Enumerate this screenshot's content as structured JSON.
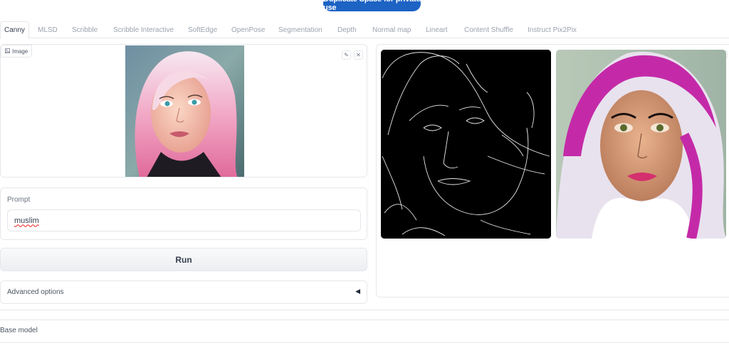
{
  "header": {
    "duplicate_label": "Duplicate Space for private use"
  },
  "tabs": [
    {
      "label": "Canny",
      "active": true
    },
    {
      "label": "MLSD"
    },
    {
      "label": "Scribble"
    },
    {
      "label": "Scribble Interactive"
    },
    {
      "label": "SoftEdge"
    },
    {
      "label": "OpenPose"
    },
    {
      "label": "Segmentation"
    },
    {
      "label": "Depth"
    },
    {
      "label": "Normal map"
    },
    {
      "label": "Lineart"
    },
    {
      "label": "Content Shuffle"
    },
    {
      "label": "Instruct Pix2Pix"
    }
  ],
  "image_input": {
    "label": "Image",
    "edit_icon": "pencil-icon",
    "clear_icon": "close-icon"
  },
  "prompt": {
    "label": "Prompt",
    "value": "muslim"
  },
  "run": {
    "label": "Run"
  },
  "advanced": {
    "label": "Advanced options",
    "caret": "◀"
  },
  "footer": {
    "base_model_label": "Base model"
  },
  "colors": {
    "accent": "#1d63c4",
    "border": "#e5e7eb"
  }
}
